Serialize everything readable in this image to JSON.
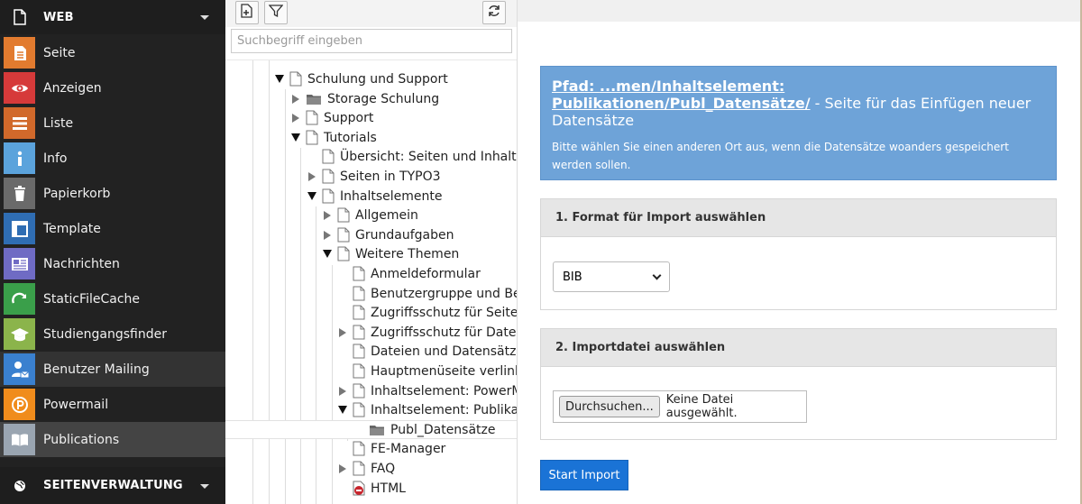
{
  "sidebar": {
    "groups": [
      {
        "label": "WEB",
        "icon": "file-icon"
      },
      {
        "label": "SEITENVERWALTUNG",
        "icon": "globe-icon"
      }
    ],
    "modules": [
      {
        "label": "Seite",
        "icon": "page-icon",
        "color": "#e27b2f"
      },
      {
        "label": "Anzeigen",
        "icon": "eye-icon",
        "color": "#d63a3a"
      },
      {
        "label": "Liste",
        "icon": "list-icon",
        "color": "#d1692b"
      },
      {
        "label": "Info",
        "icon": "info-icon",
        "color": "#5ba3dc"
      },
      {
        "label": "Papierkorb",
        "icon": "trash-icon",
        "color": "#6a6a6a"
      },
      {
        "label": "Template",
        "icon": "template-icon",
        "color": "#2f6db3"
      },
      {
        "label": "Nachrichten",
        "icon": "news-icon",
        "color": "#6f6bc4"
      },
      {
        "label": "StaticFileCache",
        "icon": "cache-icon",
        "color": "#3a9f4a"
      },
      {
        "label": "Studiengangsfinder",
        "icon": "graduation-icon",
        "color": "#8bb44b"
      },
      {
        "label": "Benutzer Mailing",
        "icon": "user-mail-icon",
        "color": "#3a80cf"
      },
      {
        "label": "Powermail",
        "icon": "powermail-icon",
        "color": "#f08c1c"
      },
      {
        "label": "Publications",
        "icon": "book-icon",
        "color": "#9aa5b1"
      }
    ]
  },
  "tree": {
    "search_placeholder": "Suchbegriff eingeben",
    "toolbar": {
      "new_page": "new-page-icon",
      "filter": "filter-icon",
      "refresh": "refresh-icon"
    },
    "items": [
      {
        "label": "Schulung und Support",
        "toggle": "open",
        "type": "page"
      },
      {
        "label": "Storage Schulung",
        "toggle": "closed",
        "type": "folder"
      },
      {
        "label": "Support",
        "toggle": "closed",
        "type": "page"
      },
      {
        "label": "Tutorials",
        "toggle": "open",
        "type": "page"
      },
      {
        "label": "Übersicht: Seiten und Inhaltse",
        "toggle": "none",
        "type": "page"
      },
      {
        "label": "Seiten in TYPO3",
        "toggle": "closed",
        "type": "page"
      },
      {
        "label": "Inhaltselemente",
        "toggle": "open",
        "type": "page"
      },
      {
        "label": "Allgemein",
        "toggle": "closed",
        "type": "page"
      },
      {
        "label": "Grundaufgaben",
        "toggle": "closed",
        "type": "page"
      },
      {
        "label": "Weitere Themen",
        "toggle": "open",
        "type": "page"
      },
      {
        "label": "Anmeldeformular",
        "toggle": "none",
        "type": "page"
      },
      {
        "label": "Benutzergruppe und Ben",
        "toggle": "none",
        "type": "page"
      },
      {
        "label": "Zugriffsschutz für Seiten",
        "toggle": "none",
        "type": "page"
      },
      {
        "label": "Zugriffsschutz für Dateie",
        "toggle": "closed",
        "type": "page"
      },
      {
        "label": "Dateien und Datensätze",
        "toggle": "none",
        "type": "page"
      },
      {
        "label": "Hauptmenüseite verlinke",
        "toggle": "none",
        "type": "page"
      },
      {
        "label": "Inhaltselement: PowerMa",
        "toggle": "closed",
        "type": "page"
      },
      {
        "label": "Inhaltselement: Publikati",
        "toggle": "open",
        "type": "page"
      },
      {
        "label": "Publ_Datensätze",
        "toggle": "none",
        "type": "folder"
      },
      {
        "label": "FE-Manager",
        "toggle": "none",
        "type": "page"
      },
      {
        "label": "FAQ",
        "toggle": "closed",
        "type": "page"
      },
      {
        "label": "HTML",
        "toggle": "none",
        "type": "restricted"
      }
    ]
  },
  "content": {
    "path_prefix": "Pfad: ",
    "path_link": "...men/Inhaltselement: Publikationen/Publ_Datensätze/",
    "path_suffix": " - Seite für das Einfügen neuer Datensätze",
    "info_text": "Bitte wählen Sie einen anderen Ort aus, wenn die Datensätze woanders gespeichert werden sollen.",
    "step1_title": "1. Format für Import auswählen",
    "format_selected": "BIB",
    "step2_title": "2. Importdatei auswählen",
    "file_button": "Durchsuchen...",
    "file_status": "Keine Datei ausgewählt.",
    "start_button": "Start Import",
    "colors": {
      "info_bg": "#6ea3d8",
      "primary": "#1a73d6"
    }
  }
}
